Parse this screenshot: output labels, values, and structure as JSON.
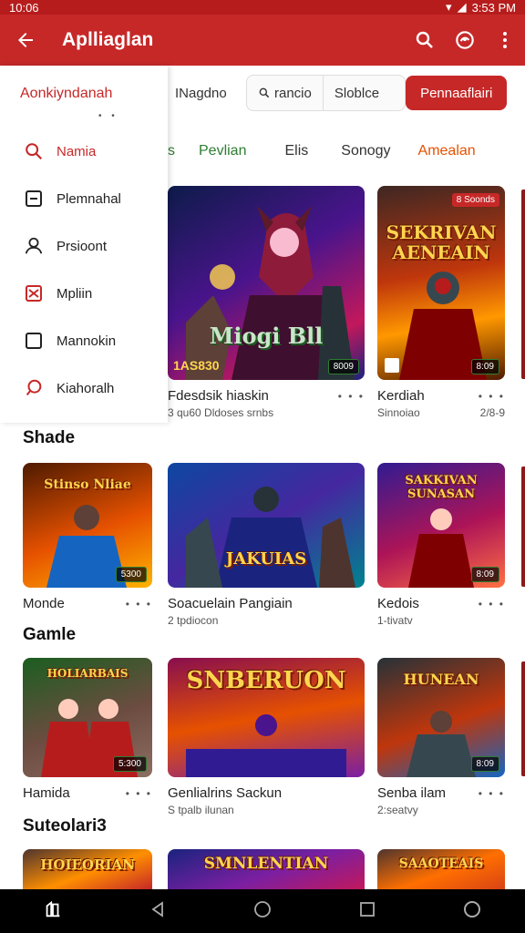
{
  "status": {
    "time": "10:06",
    "right_text": "3:53 PM"
  },
  "appbar": {
    "title": "Aplliaglan",
    "icons": [
      "back-arrow-icon",
      "search-icon",
      "notification-icon",
      "more-vert-icon"
    ]
  },
  "drawer": {
    "header": "Aonkiyndanah",
    "items": [
      {
        "label": "Namia",
        "icon": "search-icon",
        "active": true
      },
      {
        "label": "Plemnahal",
        "icon": "minus-square-icon"
      },
      {
        "label": "Prsioont",
        "icon": "person-icon"
      },
      {
        "label": "Mpliin",
        "icon": "mail-icon"
      },
      {
        "label": "Mannokin",
        "icon": "square-icon"
      },
      {
        "label": "Kiahoralh",
        "icon": "chat-icon"
      }
    ]
  },
  "filter": {
    "label": "INagdno",
    "search_text": "rancio",
    "sort_text": "Sloblce",
    "button": "Pennaaflairi"
  },
  "tabs": [
    {
      "label": "s",
      "color": "#2e7d32"
    },
    {
      "label": "Pevlian",
      "color": "#2e7d32"
    },
    {
      "label": "Elis",
      "color": "#333333"
    },
    {
      "label": "Sonogy",
      "color": "#333333"
    },
    {
      "label": "Amealan",
      "color": "#e65100"
    }
  ],
  "featured": [
    {
      "title": "Fdesdsik hiaskin",
      "sub": "3 qu60 Dldoses srnbs",
      "art_text": "Miogi Bll",
      "art_score": "1AS830",
      "badge": "8009",
      "colors": [
        "#1a237e",
        "#6a1b9a",
        "#e91e63"
      ]
    },
    {
      "title": "Kerdiah",
      "sub": "Sinnoiao",
      "meta": "2/8-9",
      "art_text": "SEKRIVAN AENEAIN",
      "top_badge": "8 Soonds",
      "badge": "8:09",
      "colors": [
        "#3e2723",
        "#bf360c",
        "#ff9800"
      ]
    }
  ],
  "sections": [
    {
      "title": "Shade",
      "cards": [
        {
          "title": "Monde",
          "sub": "",
          "art_text": "Stinso Nliae",
          "badge": "5300",
          "colors": [
            "#4e1a00",
            "#e65100",
            "#ffb300"
          ]
        },
        {
          "title": "Soacuelain Pangiain",
          "sub": "2 tpdiocon",
          "art_text": "JAKUIAS",
          "badge": "",
          "colors": [
            "#0d47a1",
            "#4527a0",
            "#00838f"
          ]
        },
        {
          "title": "Kedois",
          "sub": "1-tivatv",
          "art_text": "SAKKIVAN SUNASAN",
          "badge": "8:09",
          "colors": [
            "#311b92",
            "#ad1457",
            "#ff7043"
          ]
        }
      ]
    },
    {
      "title": "Gamle",
      "cards": [
        {
          "title": "Hamida",
          "sub": "",
          "art_text": "HOLIARBAIS",
          "badge": "5:300",
          "colors": [
            "#1b5e20",
            "#6d4c41",
            "#8d6e63"
          ]
        },
        {
          "title": "Genlialrins Sackun",
          "sub": "S tpalb ilunan",
          "art_text": "SNBERUON",
          "badge": "",
          "colors": [
            "#880e4f",
            "#e65100",
            "#7b1fa2"
          ]
        },
        {
          "title": "Senba ilam",
          "sub": "2:seatvy",
          "art_text": "HUNEAN",
          "badge": "8:09",
          "colors": [
            "#263238",
            "#bf360c",
            "#1565c0"
          ]
        }
      ]
    },
    {
      "title": "Suteolari3",
      "cards": [
        {
          "title": "",
          "sub": "",
          "art_text": "HOIEORIAN",
          "badge": "",
          "colors": [
            "#4e342e",
            "#ff8f00",
            "#c62828"
          ]
        },
        {
          "title": "",
          "sub": "",
          "art_text": "SMNLENTIAN",
          "badge": "",
          "colors": [
            "#1a237e",
            "#7b1fa2",
            "#c2185b"
          ]
        },
        {
          "title": "",
          "sub": "",
          "art_text": "SAAOTEAIS",
          "badge": "",
          "colors": [
            "#4e342e",
            "#ff6f00",
            "#d84315"
          ]
        }
      ]
    }
  ],
  "accent": "#c62828"
}
